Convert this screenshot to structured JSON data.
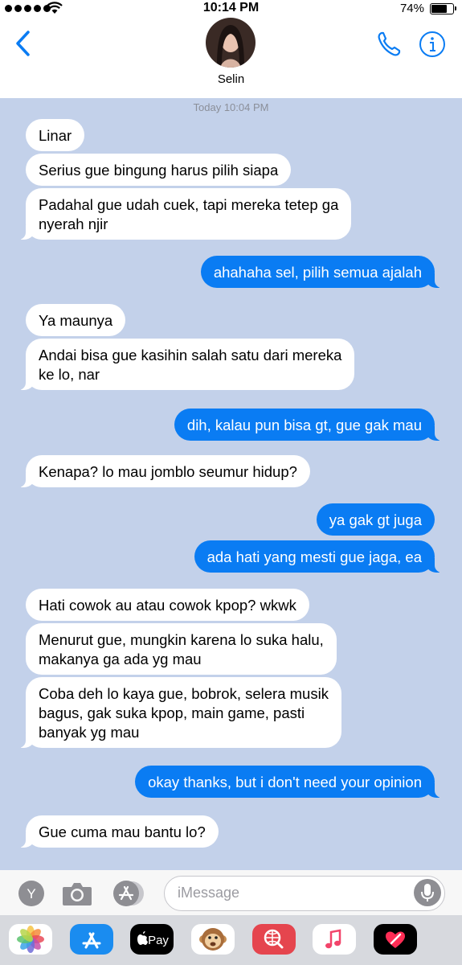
{
  "status": {
    "time": "10:14 PM",
    "battery": "74%",
    "battery_level": 0.74
  },
  "header": {
    "contact_name": "Selin"
  },
  "chat": {
    "timestamp": "Today 10:04 PM",
    "messages": [
      {
        "dir": "in",
        "text": "Linar"
      },
      {
        "dir": "in",
        "text": "Serius gue bingung harus pilih siapa"
      },
      {
        "dir": "in",
        "text": "Padahal gue udah cuek, tapi mereka tetep ga\nnyerah njir"
      },
      {
        "dir": "out",
        "text": "ahahaha sel, pilih semua ajalah"
      },
      {
        "dir": "in",
        "text": "Ya maunya"
      },
      {
        "dir": "in",
        "text": "Andai bisa gue kasihin salah satu dari mereka\nke lo, nar"
      },
      {
        "dir": "out",
        "text": "dih, kalau pun bisa gt, gue gak mau"
      },
      {
        "dir": "in",
        "text": "Kenapa? lo mau jomblo seumur hidup?"
      },
      {
        "dir": "out",
        "text": "ya gak gt juga"
      },
      {
        "dir": "out",
        "text": "ada hati yang mesti gue jaga, ea"
      },
      {
        "dir": "in",
        "text": "Hati cowok au atau cowok kpop? wkwk"
      },
      {
        "dir": "in",
        "text": "Menurut gue, mungkin karena lo suka halu,\nmakanya ga ada yg mau"
      },
      {
        "dir": "in",
        "text": "Coba deh lo kaya gue, bobrok, selera musik\nbagus, gak suka kpop, main game, pasti\nbanyak yg mau"
      },
      {
        "dir": "out",
        "text": "okay thanks, but i don't need your opinion"
      },
      {
        "dir": "in",
        "text": "Gue cuma mau bantu lo?"
      }
    ]
  },
  "input": {
    "placeholder": "iMessage",
    "memoji_letter": "Y",
    "camera_icon": "camera-icon",
    "apps_icon": "app-store-icon",
    "mic_icon": "microphone-icon"
  },
  "app_tray": {
    "apps": [
      {
        "name": "photos-app-icon",
        "label": ""
      },
      {
        "name": "app-store-app-icon",
        "label": ""
      },
      {
        "name": "apple-pay-app-icon",
        "label": "Pay"
      },
      {
        "name": "animoji-app-icon",
        "label": ""
      },
      {
        "name": "web-search-app-icon",
        "label": ""
      },
      {
        "name": "music-app-icon",
        "label": ""
      },
      {
        "name": "digital-touch-app-icon",
        "label": ""
      }
    ]
  },
  "colors": {
    "chat_background": "#c3d1ea",
    "outgoing_bubble": "#0a7cf3",
    "incoming_bubble": "#ffffff",
    "accent": "#0a7cf3"
  }
}
